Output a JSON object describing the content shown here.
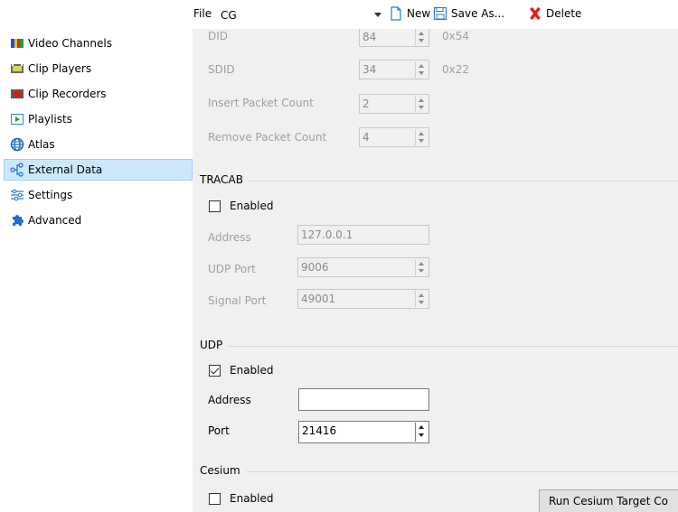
{
  "sidebar": {
    "items": [
      {
        "label": "Video Channels",
        "icon": "video-channels-icon"
      },
      {
        "label": "Clip Players",
        "icon": "clip-players-icon"
      },
      {
        "label": "Clip Recorders",
        "icon": "clip-recorders-icon"
      },
      {
        "label": "Playlists",
        "icon": "playlists-icon"
      },
      {
        "label": "Atlas",
        "icon": "globe-icon"
      },
      {
        "label": "External Data",
        "icon": "external-data-icon",
        "selected": true
      },
      {
        "label": "Settings",
        "icon": "sliders-icon"
      },
      {
        "label": "Advanced",
        "icon": "puzzle-icon"
      }
    ],
    "selected_color": "#cce8ff"
  },
  "toolbar": {
    "file_label": "File",
    "file_value": "CG",
    "new_label": "New",
    "save_as_label": "Save As...",
    "delete_label": "Delete"
  },
  "sdi": {
    "did_label": "DID",
    "did_value": "84",
    "did_hex": "0x54",
    "sdid_label": "SDID",
    "sdid_value": "34",
    "sdid_hex": "0x22",
    "insert_label": "Insert Packet Count",
    "insert_value": "2",
    "remove_label": "Remove Packet Count",
    "remove_value": "4"
  },
  "tracab": {
    "title": "TRACAB",
    "enabled_label": "Enabled",
    "enabled": false,
    "address_label": "Address",
    "address_value": "127.0.0.1",
    "udp_port_label": "UDP Port",
    "udp_port_value": "9006",
    "signal_port_label": "Signal Port",
    "signal_port_value": "49001"
  },
  "udp": {
    "title": "UDP",
    "enabled_label": "Enabled",
    "enabled": true,
    "address_label": "Address",
    "address_value": "",
    "port_label": "Port",
    "port_value": "21416"
  },
  "cesium": {
    "title": "Cesium",
    "enabled_label": "Enabled",
    "enabled": false,
    "run_button_label": "Run Cesium Target Co"
  },
  "colors": {
    "panel_bg": "#f0f0f0",
    "delete_red": "#e02020",
    "new_blue": "#2a7bd6"
  }
}
